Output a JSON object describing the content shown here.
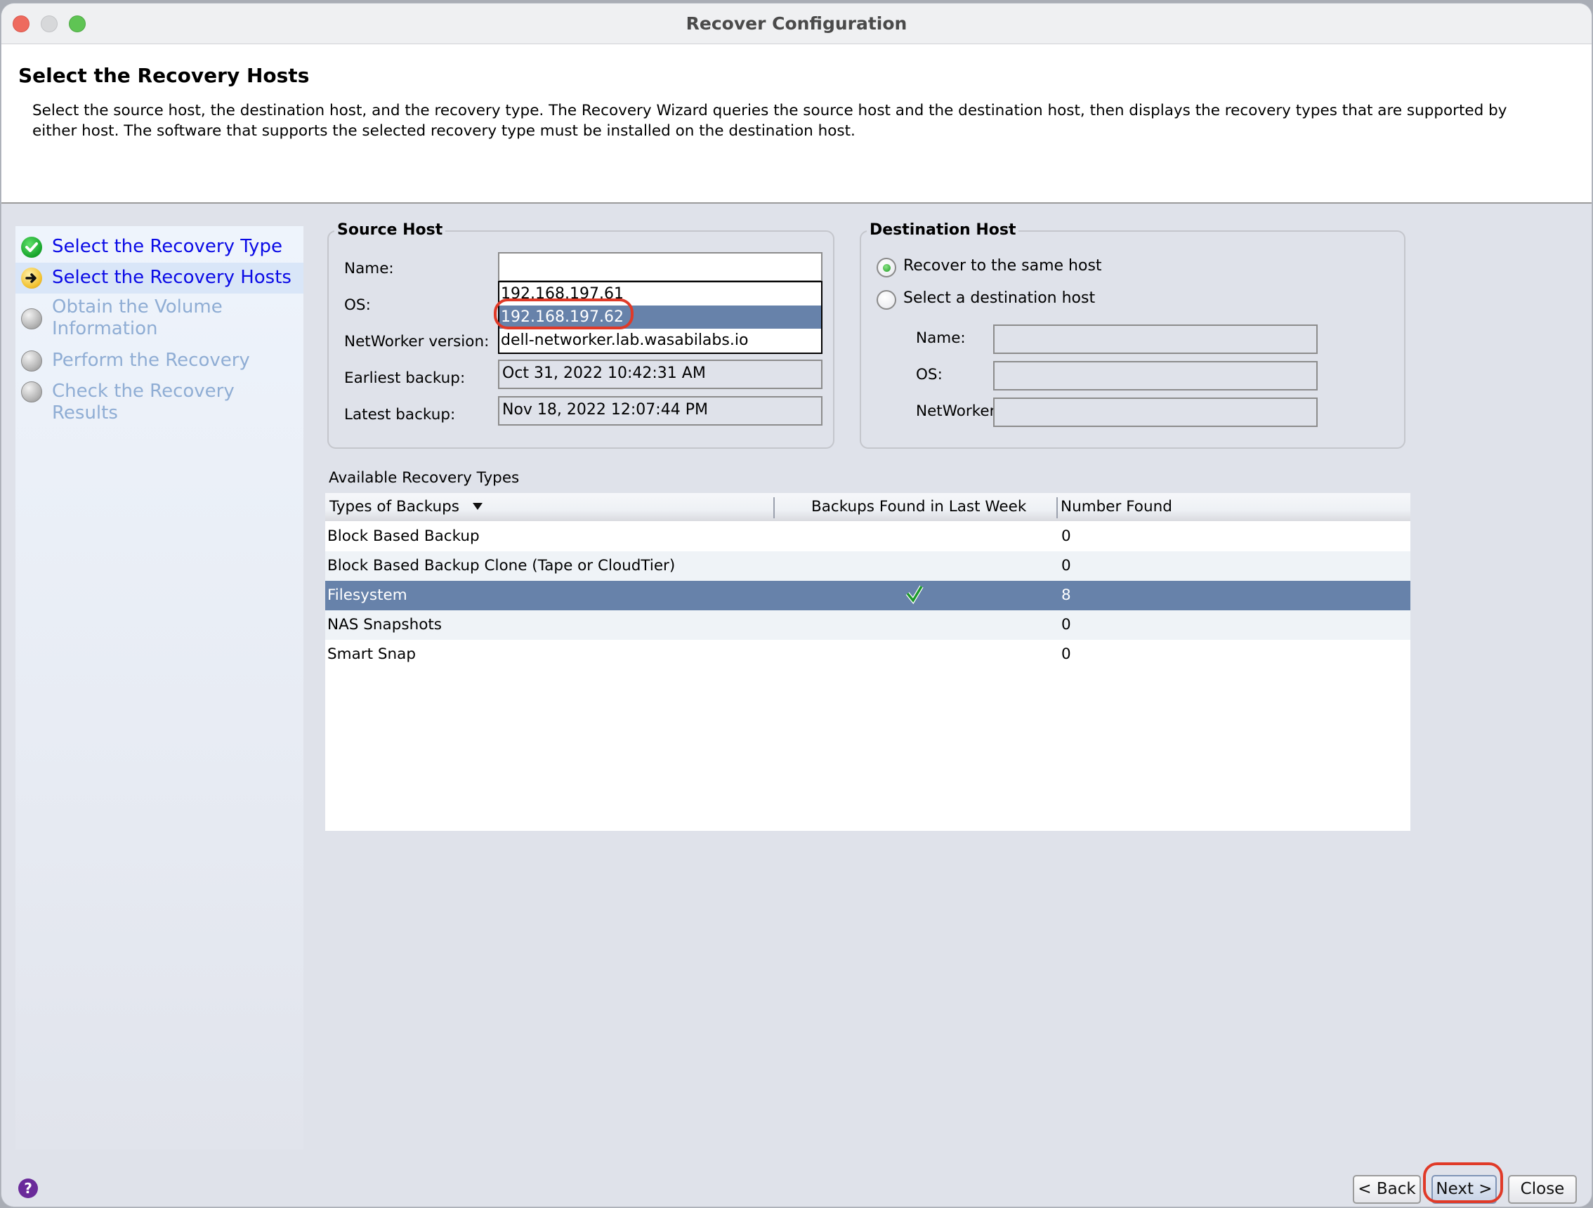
{
  "window": {
    "title": "Recover Configuration"
  },
  "header": {
    "title": "Select the Recovery Hosts",
    "description": "Select the source host, the destination host, and the recovery type. The Recovery Wizard queries the source host and the destination host, then displays the recovery types that are supported by either host. The software that supports the selected recovery type must be installed on the destination host."
  },
  "steps": [
    {
      "label": "Select the Recovery Type",
      "status": "completed",
      "icon": "check-circle-icon"
    },
    {
      "label": "Select the Recovery Hosts",
      "status": "current",
      "icon": "arrow-circle-icon"
    },
    {
      "label": "Obtain the Volume Information",
      "status": "pending",
      "icon": "grey-circle-icon"
    },
    {
      "label": "Perform the Recovery",
      "status": "pending",
      "icon": "grey-circle-icon"
    },
    {
      "label": "Check the Recovery Results",
      "status": "pending",
      "icon": "grey-circle-icon"
    }
  ],
  "source_host": {
    "title": "Source Host",
    "name_label": "Name:",
    "name_value": "",
    "os_label": "OS:",
    "networker_label": "NetWorker version:",
    "earliest_label": "Earliest backup:",
    "earliest_value": "Oct 31, 2022 10:42:31 AM",
    "latest_label": "Latest backup:",
    "latest_value": "Nov 18, 2022 12:07:44 PM",
    "dropdown_options": [
      {
        "label": "192.168.197.61",
        "selected": false
      },
      {
        "label": "192.168.197.62",
        "selected": true
      },
      {
        "label": "dell-networker.lab.wasabilabs.io",
        "selected": false
      }
    ]
  },
  "destination_host": {
    "title": "Destination Host",
    "radio_same": "Recover to the same host",
    "radio_same_checked": true,
    "radio_select": "Select a destination host",
    "radio_select_checked": false,
    "name_label": "Name:",
    "name_value": "",
    "os_label": "OS:",
    "os_value": "",
    "networker_label": "NetWorker version:",
    "networker_value": ""
  },
  "recovery_types": {
    "section_label": "Available Recovery Types",
    "columns": [
      "Types of Backups",
      "Backups Found in Last Week",
      "Number Found"
    ],
    "rows": [
      {
        "type": "Block Based Backup",
        "found_last_week": false,
        "number": "0",
        "selected": false
      },
      {
        "type": "Block Based Backup Clone (Tape or CloudTier)",
        "found_last_week": false,
        "number": "0",
        "selected": false
      },
      {
        "type": "Filesystem",
        "found_last_week": true,
        "number": "8",
        "selected": true
      },
      {
        "type": "NAS Snapshots",
        "found_last_week": false,
        "number": "0",
        "selected": false
      },
      {
        "type": "Smart Snap",
        "found_last_week": false,
        "number": "0",
        "selected": false
      }
    ]
  },
  "footer": {
    "help_icon": "?",
    "back_label": "< Back",
    "next_label": "Next >",
    "close_label": "Close"
  },
  "colors": {
    "selection": "#6782aa",
    "annotation": "#e03a28",
    "step_link": "#0a0ae6",
    "step_pending": "#8fadd4"
  }
}
